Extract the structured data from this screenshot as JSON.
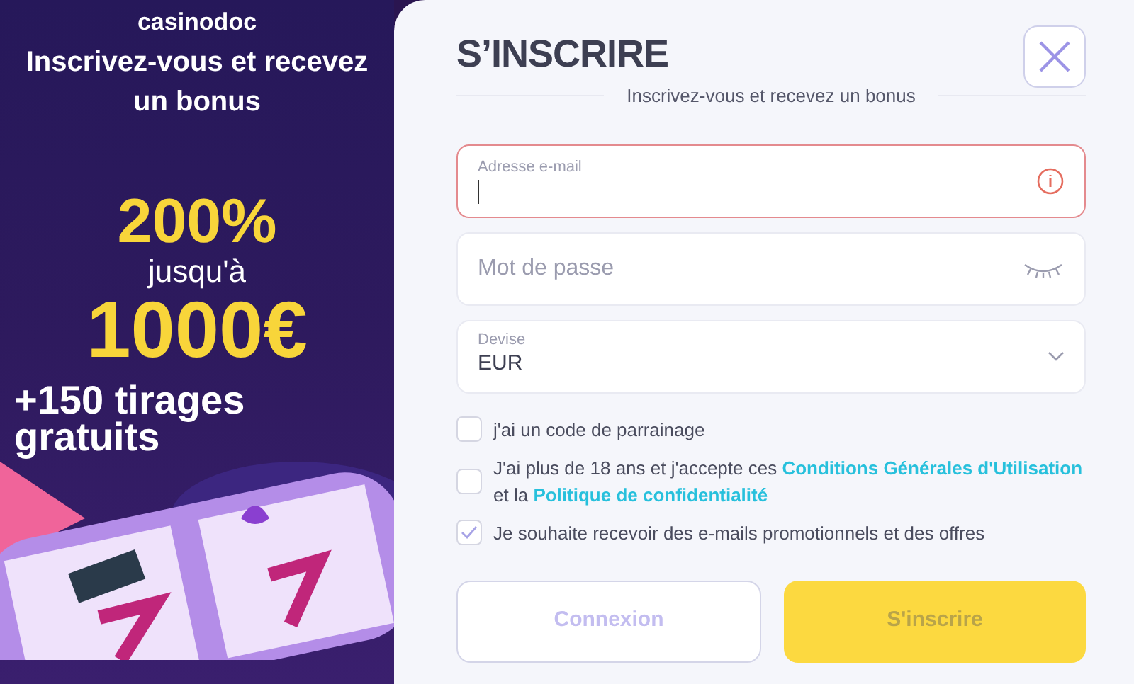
{
  "promo": {
    "logo": "casinodoc",
    "headline": "Inscrivez-vous et recevez un bonus",
    "percent": "200%",
    "upto": "jusqu'à",
    "amount": "1000€",
    "spins": "+150 tirages gratuits"
  },
  "form": {
    "title": "S’INSCRIRE",
    "subtitle": "Inscrivez-vous et recevez un bonus",
    "email": {
      "label": "Adresse e-mail",
      "error": true
    },
    "password": {
      "placeholder": "Mot de passe"
    },
    "currency": {
      "label": "Devise",
      "value": "EUR"
    },
    "checkboxes": [
      {
        "checked": false,
        "parts": [
          {
            "kind": "text",
            "text": "j'ai un code de parrainage"
          }
        ]
      },
      {
        "checked": false,
        "parts": [
          {
            "kind": "text",
            "text": "J'ai plus de 18 ans et j'accepte ces "
          },
          {
            "kind": "link",
            "text": "Conditions Générales d'Utilisation"
          },
          {
            "kind": "text",
            "text": " et la "
          },
          {
            "kind": "link",
            "text": "Politique de confidentialité"
          }
        ]
      },
      {
        "checked": true,
        "parts": [
          {
            "kind": "text",
            "text": "Je souhaite recevoir des e-mails promotionnels et des offres"
          }
        ]
      }
    ],
    "buttons": [
      {
        "label": "Connexion",
        "kind": "outline",
        "disabled": true
      },
      {
        "label": "S'inscrire",
        "kind": "primary",
        "disabled": true
      }
    ]
  }
}
